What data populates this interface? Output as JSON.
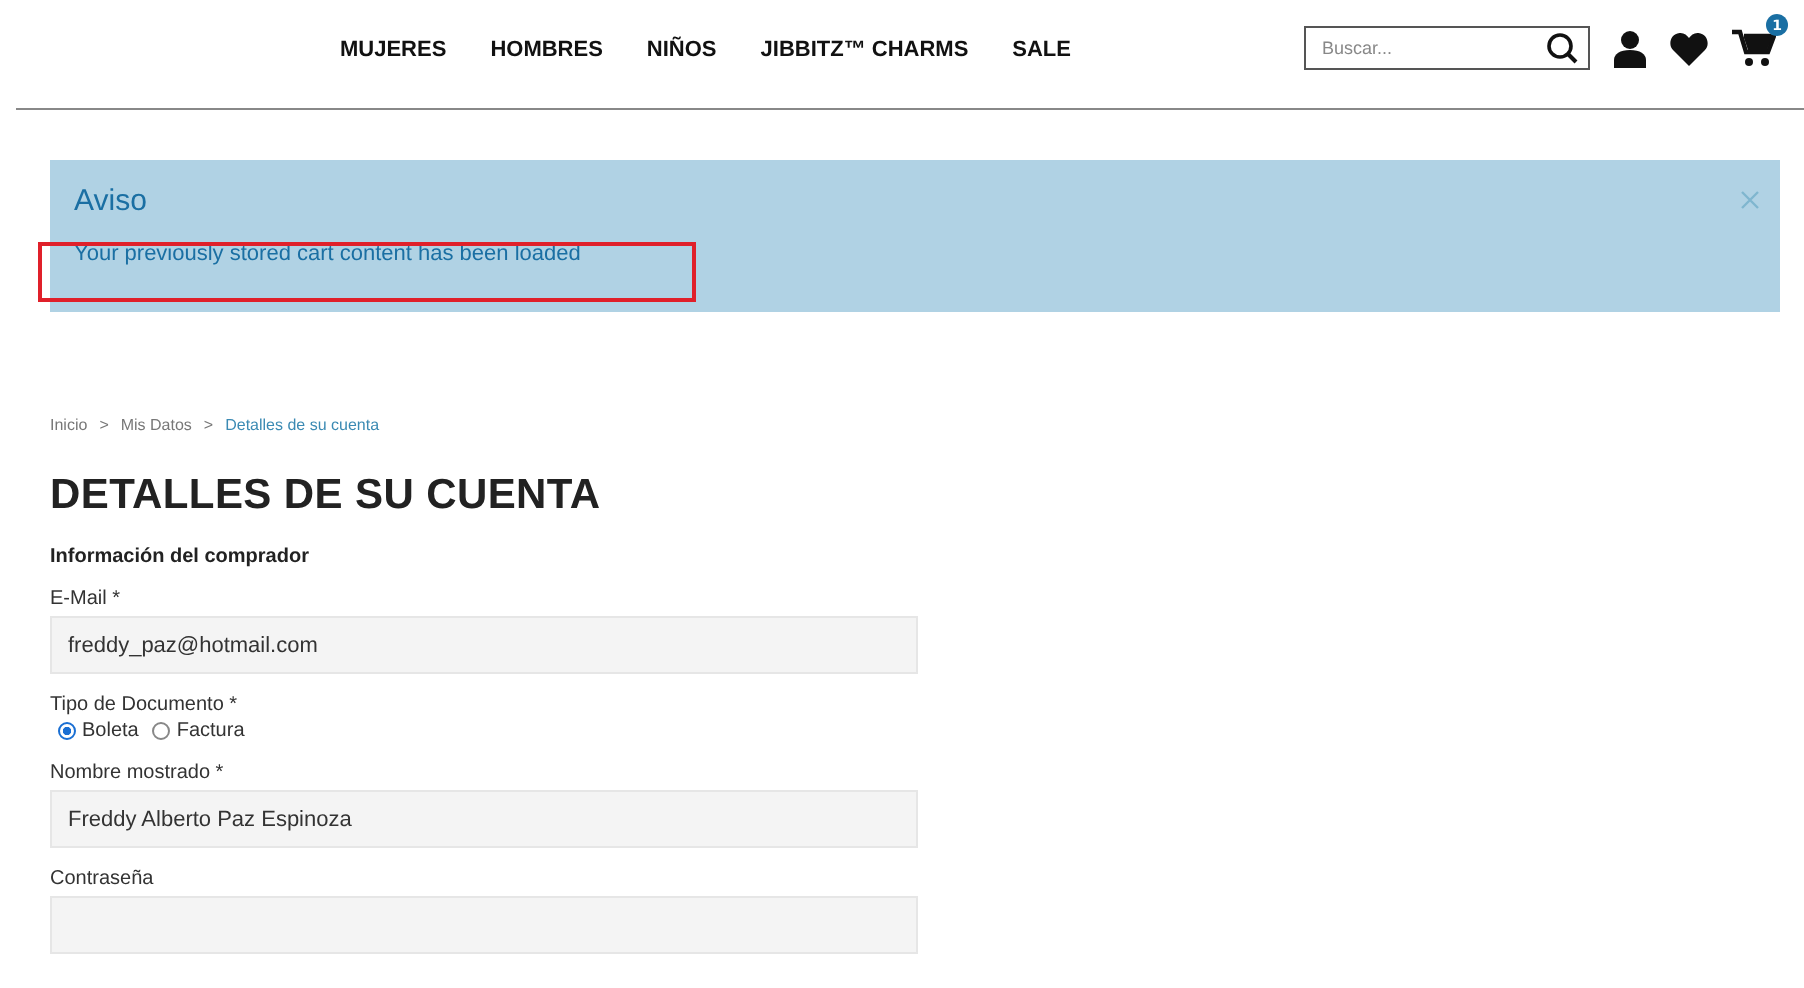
{
  "nav": {
    "items": [
      "MUJERES",
      "HOMBRES",
      "NIÑOS",
      "JIBBITZ™ CHARMS",
      "SALE"
    ]
  },
  "search": {
    "placeholder": "Buscar..."
  },
  "cart": {
    "badge": "1"
  },
  "notice": {
    "title": "Aviso",
    "message": "Your previously stored cart content has been loaded",
    "highlighted": true
  },
  "breadcrumb": [
    {
      "label": "Inicio",
      "current": false
    },
    {
      "label": "Mis Datos",
      "current": false
    },
    {
      "label": "Detalles de su cuenta",
      "current": true
    }
  ],
  "breadcrumb_separator": ">",
  "page_title": "DETALLES DE SU CUENTA",
  "section_title": "Información del comprador",
  "fields": [
    {
      "kind": "text",
      "label": "E-Mail *",
      "value": "freddy_paz@hotmail.com"
    },
    {
      "kind": "radio",
      "label": "Tipo de Documento *",
      "options": [
        {
          "label": "Boleta",
          "selected": true
        },
        {
          "label": "Factura",
          "selected": false
        }
      ]
    },
    {
      "kind": "text",
      "label": "Nombre mostrado *",
      "value": "Freddy Alberto Paz Espinoza"
    },
    {
      "kind": "text",
      "label": "Contraseña"
    }
  ]
}
